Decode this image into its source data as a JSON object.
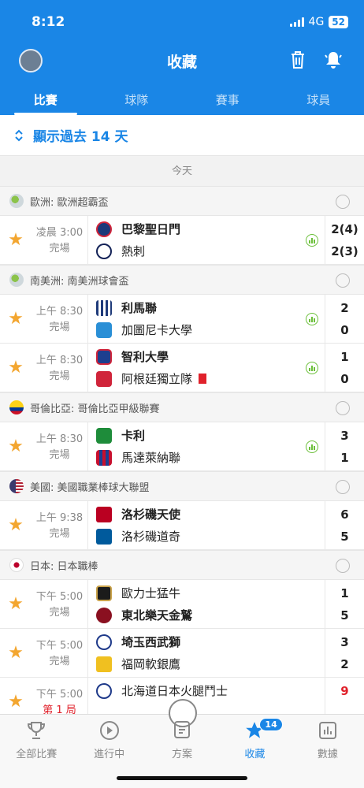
{
  "status": {
    "time": "8:12",
    "network": "4G",
    "battery": "52"
  },
  "header": {
    "title": "收藏",
    "trash_icon": "trash-icon",
    "bell_icon": "bell-icon"
  },
  "tabs": [
    {
      "label": "比賽",
      "active": true
    },
    {
      "label": "球隊"
    },
    {
      "label": "賽事"
    },
    {
      "label": "球員"
    }
  ],
  "past_toggle": "顯示過去 14 天",
  "day_label": "今天",
  "leagues": [
    {
      "name": "歐洲: 歐洲超霸盃",
      "matches": [
        {
          "time": "凌晨 3:00",
          "status": "完場",
          "home": "巴黎聖日門",
          "away": "熱刺",
          "home_score": "2(4)",
          "away_score": "2(3)",
          "home_bold": true,
          "away_bold": false
        }
      ]
    },
    {
      "name": "南美洲: 南美洲球會盃",
      "matches": [
        {
          "time": "上午 8:30",
          "status": "完場",
          "home": "利馬聯",
          "away": "加圖尼卡大學",
          "home_score": "2",
          "away_score": "0",
          "home_bold": true,
          "away_bold": false
        },
        {
          "time": "上午 8:30",
          "status": "完場",
          "home": "智利大學",
          "away": "阿根廷獨立隊",
          "home_score": "1",
          "away_score": "0",
          "home_bold": true,
          "away_bold": false
        }
      ]
    },
    {
      "name": "哥倫比亞: 哥倫比亞甲級聯賽",
      "matches": [
        {
          "time": "上午 8:30",
          "status": "完場",
          "home": "卡利",
          "away": "馬達萊納聯",
          "home_score": "3",
          "away_score": "1",
          "home_bold": true,
          "away_bold": false
        }
      ]
    },
    {
      "name": "美國: 美國職業棒球大聯盟",
      "matches": [
        {
          "time": "上午 9:38",
          "status": "完場",
          "home": "洛杉磯天使",
          "away": "洛杉磯道奇",
          "home_score": "6",
          "away_score": "5",
          "home_bold": true,
          "away_bold": false
        }
      ]
    },
    {
      "name": "日本: 日本職棒",
      "matches": [
        {
          "time": "下午 5:00",
          "status": "完場",
          "home": "歐力士猛牛",
          "away": "東北樂天金鷲",
          "home_score": "1",
          "away_score": "5",
          "home_bold": false,
          "away_bold": true
        },
        {
          "time": "下午 5:00",
          "status": "完場",
          "home": "埼玉西武獅",
          "away": "福岡軟銀鷹",
          "home_score": "3",
          "away_score": "2",
          "home_bold": true,
          "away_bold": false
        },
        {
          "time": "下午 5:00",
          "status": "第 1 局",
          "home": "北海道日本火腿鬥士",
          "away": "",
          "home_score": "9",
          "away_score": "",
          "home_bold": false,
          "away_bold": false
        }
      ]
    }
  ],
  "bottom_nav": [
    {
      "label": "全部比賽",
      "icon": "trophy-icon"
    },
    {
      "label": "進行中",
      "icon": "play-icon"
    },
    {
      "label": "方案",
      "icon": "plan-icon"
    },
    {
      "label": "收藏",
      "icon": "star-icon",
      "active": true,
      "badge": "14"
    },
    {
      "label": "數據",
      "icon": "chart-icon"
    }
  ],
  "colors": {
    "primary": "#1a86e6",
    "star": "#f3a630",
    "red_card": "#e0212b",
    "live": "#6bbf3a"
  }
}
